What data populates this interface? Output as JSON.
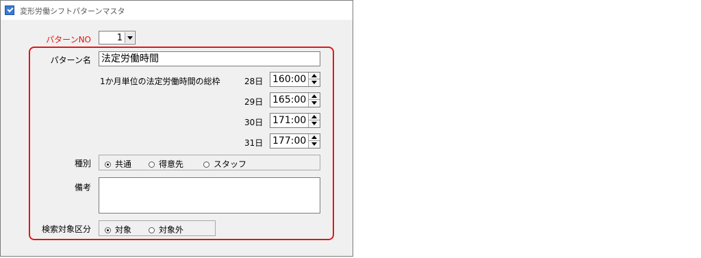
{
  "window": {
    "title": "変形労働シフトパターンマスタ",
    "icon": "app-check-icon"
  },
  "pattern_no": {
    "label": "パターンNO",
    "value": "1"
  },
  "pattern_name": {
    "label": "パターン名",
    "value": "法定労働時間"
  },
  "monthly_total": {
    "label": "1か月単位の法定労働時間の総枠",
    "rows": [
      {
        "day": "28日",
        "value": "160:00"
      },
      {
        "day": "29日",
        "value": "165:00"
      },
      {
        "day": "30日",
        "value": "171:00"
      },
      {
        "day": "31日",
        "value": "177:00"
      }
    ]
  },
  "kind": {
    "label": "種別",
    "options": [
      "共通",
      "得意先",
      "スタッフ"
    ],
    "selected": "共通"
  },
  "remarks": {
    "label": "備考",
    "value": ""
  },
  "search_target": {
    "label": "検索対象区分",
    "options": [
      "対象",
      "対象外"
    ],
    "selected": "対象"
  },
  "colors": {
    "highlight_frame": "#e01515",
    "required_label": "#e01515"
  }
}
